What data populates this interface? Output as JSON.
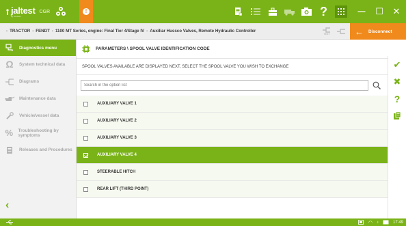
{
  "app": {
    "brand": "jaltest",
    "brand_sub": "by COJALI",
    "product": "CGR"
  },
  "topbar": {
    "alert_glyph": "!",
    "icons": [
      "report-icon",
      "list-icon",
      "toolbox-icon",
      "truck-icon",
      "camera-icon",
      "help-icon",
      "grid-icon"
    ],
    "help_glyph": "?",
    "minimize_glyph": "—",
    "maximize_glyph": "☐",
    "close_glyph": "✕"
  },
  "breadcrumb": [
    "TRACTOR",
    "FENDT",
    "1100 MT Series, engine: Final Tier 4/Stage IV",
    "Auxiliar Hussco Valves, Remote Hydraulic Controller"
  ],
  "breadcrumb_sep": "›",
  "connection": {
    "test_label": "TEST",
    "disconnect_label": "Disconnect"
  },
  "sidebar": {
    "items": [
      {
        "label": "Diagnostics menu",
        "icon": "diagnostics-icon",
        "active": true
      },
      {
        "label": "System technical data",
        "icon": "ohm-icon",
        "active": false
      },
      {
        "label": "Diagrams",
        "icon": "diagram-icon",
        "active": false
      },
      {
        "label": "Maintenance data",
        "icon": "oil-can-icon",
        "active": false
      },
      {
        "label": "Vehicle/vessel data",
        "icon": "wrench-icon",
        "active": false
      },
      {
        "label": "Troubleshooting by symptoms",
        "icon": "percent-icon",
        "active": false
      },
      {
        "label": "Releases and Procedures",
        "icon": "document-icon",
        "active": false
      }
    ],
    "back_glyph": "‹"
  },
  "main": {
    "title": "PARAMETERS \\ SPOOL VALVE IDENTIFICATION CODE",
    "instruction": "SPOOL VALVES AVAILABLE ARE DISPLAYED NEXT, SELECT THE SPOOL VALVE YOU WISH TO EXCHANGE",
    "search_placeholder": "Search in the option list",
    "options": [
      {
        "label": "AUXILIARY VALVE 1",
        "selected": false
      },
      {
        "label": "AUXILIARY VALVE 2",
        "selected": false
      },
      {
        "label": "AUXILIARY VALVE 3",
        "selected": false
      },
      {
        "label": "AUXILIARY VALVE 4",
        "selected": true
      },
      {
        "label": "STEERABLE HITCH",
        "selected": false
      },
      {
        "label": "REAR LIFT (THIRD POINT)",
        "selected": false
      }
    ]
  },
  "actions": {
    "accept_glyph": "✔",
    "cancel_glyph": "✖",
    "help_glyph": "?"
  },
  "statusbar": {
    "time": "17:49"
  },
  "colors": {
    "accent": "#7ab317",
    "warning": "#f08a1c"
  }
}
